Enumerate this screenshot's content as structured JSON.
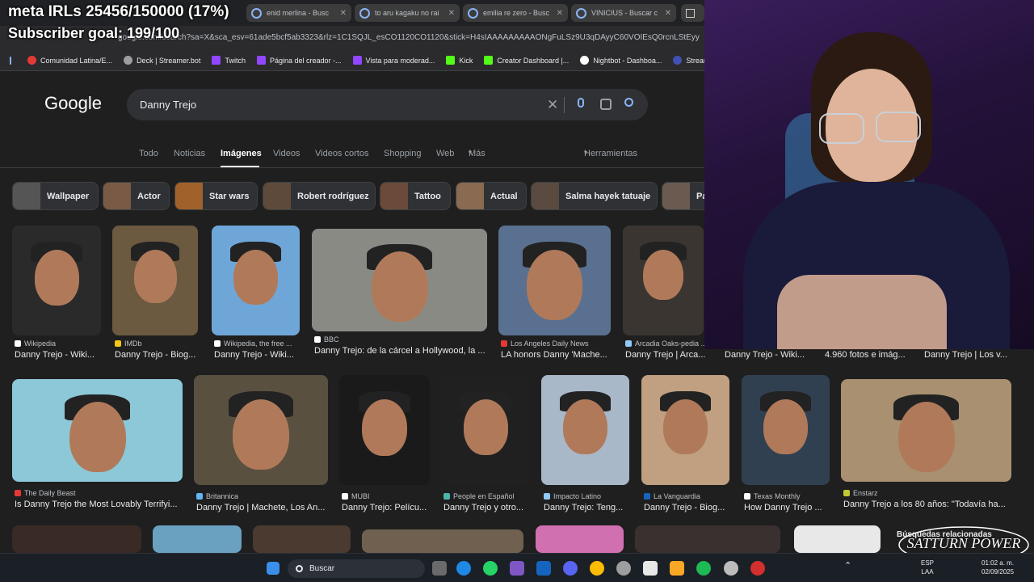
{
  "overlay": {
    "meta": "meta IRLs 25456/150000 (17%)",
    "goal": "Subscriber goal: 199/100"
  },
  "tabs": [
    {
      "label": "enid merlina - Busc"
    },
    {
      "label": "to aru kagaku no rai"
    },
    {
      "label": "emilia re zero - Busc"
    },
    {
      "label": "VINICIUS - Buscar c"
    }
  ],
  "address": {
    "url": "google.com/search?sa=X&sca_esv=61ade5bcf5ab3323&rlz=1C1SQJL_esCO1120CO1120&stick=H4sIAAAAAAAAAONgFuLSz9U3qDAyyC60VOIEsQ0rcnLStEyy"
  },
  "bookmarks": [
    {
      "label": "Comunidad Latina/E...",
      "color": "#e53935"
    },
    {
      "label": "Deck | Streamer.bot",
      "color": "#9e9e9e"
    },
    {
      "label": "Twitch",
      "color": "#9146ff"
    },
    {
      "label": "Página del creador -...",
      "color": "#9146ff"
    },
    {
      "label": "Vista para moderad...",
      "color": "#9146ff"
    },
    {
      "label": "Kick",
      "color": "#53fc18"
    },
    {
      "label": "Creator Dashboard |...",
      "color": "#53fc18"
    },
    {
      "label": "Nightbot - Dashboa...",
      "color": "#ffffff"
    },
    {
      "label": "Stream",
      "color": "#3f51b5"
    }
  ],
  "google": {
    "logo": "Google",
    "query": "Danny Trejo"
  },
  "nav": [
    "Todo",
    "Noticias",
    "Imágenes",
    "Videos",
    "Videos cortos",
    "Shopping",
    "Web",
    "Más",
    "Herramientas"
  ],
  "chips": [
    {
      "label": "Wallpaper",
      "color": "#555"
    },
    {
      "label": "Actor",
      "color": "#7a5a45"
    },
    {
      "label": "Star wars",
      "color": "#a0622a"
    },
    {
      "label": "Robert rodríguez",
      "color": "#5d4a3a"
    },
    {
      "label": "Tattoo",
      "color": "#6b4a3a"
    },
    {
      "label": "Actual",
      "color": "#8a6a50"
    },
    {
      "label": "Salma hayek tatuaje",
      "color": "#5a4a40"
    },
    {
      "label": "Pa",
      "color": "#6a5a50"
    }
  ],
  "row1": [
    {
      "source": "Wikipedia",
      "title": "Danny Trejo - Wiki...",
      "color": "#2a2a2a",
      "fav": "#ffffff"
    },
    {
      "source": "IMDb",
      "title": "Danny Trejo - Biog...",
      "color": "#6b5a40",
      "fav": "#f5c518"
    },
    {
      "source": "Wikipedia, the free ...",
      "title": "Danny Trejo - Wiki...",
      "color": "#6fa6d8",
      "fav": "#ffffff"
    },
    {
      "source": "BBC",
      "title": "Danny Trejo: de la cárcel a Hollywood, la ...",
      "color": "#8a8a85",
      "fav": "#ffffff"
    },
    {
      "source": "Los Angeles Daily News",
      "title": "LA honors Danny 'Mache...",
      "color": "#5a7090",
      "fav": "#e53935"
    },
    {
      "source": "Arcadia Oaks-pedia ...",
      "title": "Danny Trejo | Arca...",
      "color": "#3a3530",
      "fav": "#90caf9"
    }
  ],
  "row1_extra": [
    "Danny Trejo - Wiki...",
    "4.960 fotos e imág...",
    "Danny Trejo | Los v..."
  ],
  "row2": [
    {
      "source": "The Daily Beast",
      "title": "Is Danny Trejo the Most Lovably Terrifyi...",
      "color": "#8cc8d8",
      "fav": "#e53935"
    },
    {
      "source": "Britannica",
      "title": "Danny Trejo | Machete, Los An...",
      "color": "#5a5040",
      "fav": "#64b5f6"
    },
    {
      "source": "MUBI",
      "title": "Danny Trejo: Pelícu...",
      "color": "#1a1a1a",
      "fav": "#ffffff"
    },
    {
      "source": "People en Español",
      "title": "Danny Trejo y otro...",
      "color": "#202020",
      "fav": "#4db6ac"
    },
    {
      "source": "Impacto Latino",
      "title": "Danny Trejo: Teng...",
      "color": "#a8b8c8",
      "fav": "#90caf9"
    },
    {
      "source": "La Vanguardia",
      "title": "Danny Trejo - Biog...",
      "color": "#c0a080",
      "fav": "#1565c0"
    },
    {
      "source": "Texas Monthly",
      "title": "How Danny Trejo ...",
      "color": "#304050",
      "fav": "#ffffff"
    },
    {
      "source": "Enstarz",
      "title": "Danny Trejo a los 80 años: \"Todavía ha...",
      "color": "#a89070",
      "fav": "#c0ca33"
    }
  ],
  "related": "Búsquedas relacionadas",
  "watermark": "SATTURN POWER",
  "taskbar": {
    "search": "Buscar",
    "lang1": "ESP",
    "lang2": "LAA",
    "time": "01:02 a. m.",
    "date": "02/09/2025"
  }
}
